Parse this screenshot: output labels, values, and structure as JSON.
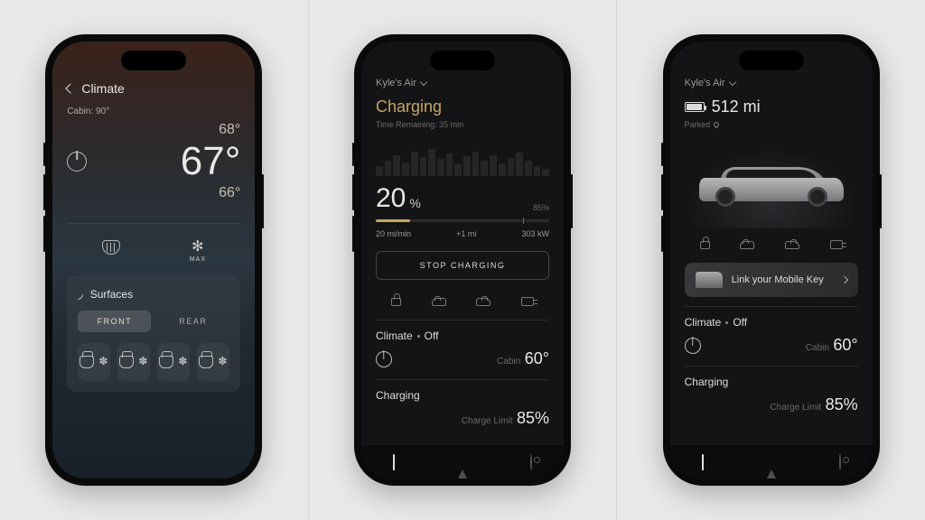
{
  "screen1": {
    "title": "Climate",
    "cabin_label": "Cabin: 90°",
    "temp_up": "68°",
    "temp_set": "67°",
    "temp_down": "66°",
    "max_label": "MAX",
    "surfaces": {
      "title": "Surfaces",
      "front": "FRONT",
      "rear": "REAR"
    }
  },
  "screen2": {
    "vehicle": "Kyle's Air",
    "title": "Charging",
    "time_remaining": "Time Remaining: 35 min",
    "percent": "20",
    "percent_sym": "%",
    "limit_label": "85%",
    "rate": "20 mi/min",
    "added": "+1 mi",
    "power": "303 kW",
    "stop": "STOP CHARGING",
    "climate": {
      "title": "Climate",
      "state": "Off",
      "label": "Cabin",
      "value": "60°"
    },
    "charging": {
      "title": "Charging",
      "label": "Charge Limit",
      "value": "85%"
    }
  },
  "screen3": {
    "vehicle": "Kyle's Air",
    "range": "512 mi",
    "parked": "Parked",
    "link_key": "Link your Mobile Key",
    "climate": {
      "title": "Climate",
      "state": "Off",
      "label": "Cabin",
      "value": "60°"
    },
    "charging": {
      "title": "Charging",
      "label": "Charge Limit",
      "value": "85%"
    }
  }
}
